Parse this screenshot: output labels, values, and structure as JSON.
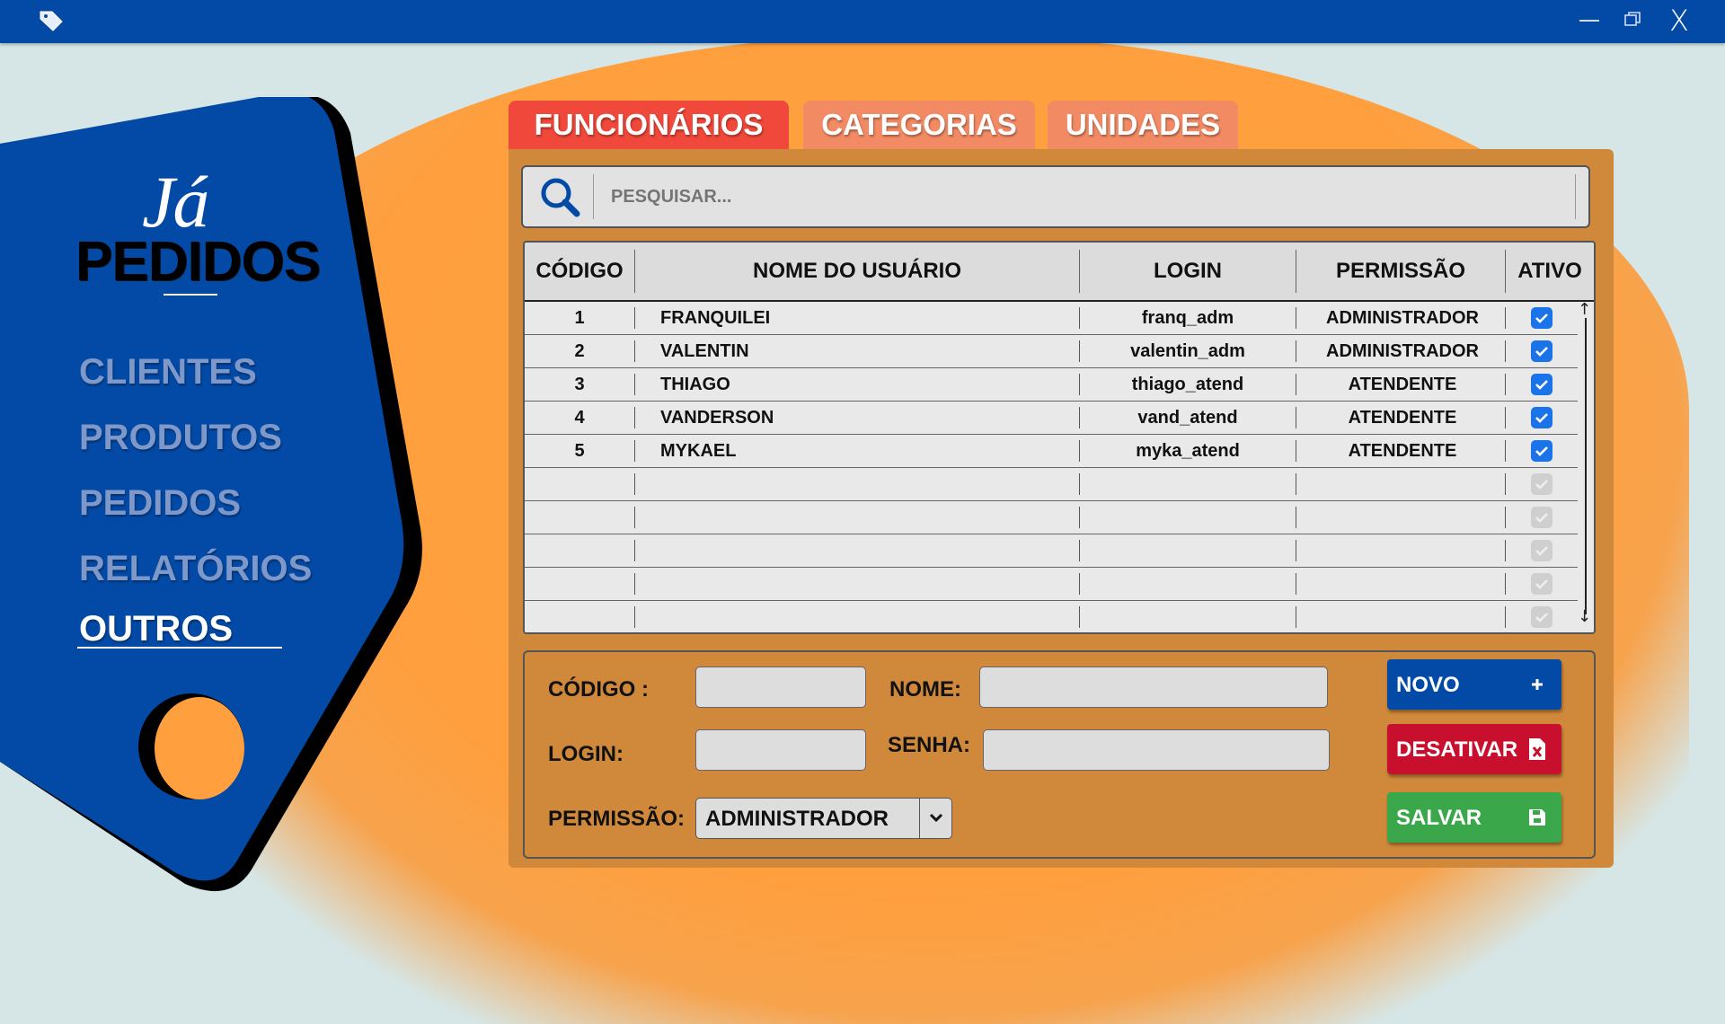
{
  "window": {
    "close_label": "X"
  },
  "brand": {
    "ja": "Já",
    "pedidos": "PEDIDOS"
  },
  "nav": {
    "items": [
      {
        "label": "CLIENTES"
      },
      {
        "label": "PRODUTOS"
      },
      {
        "label": "PEDIDOS"
      },
      {
        "label": "RELATÓRIOS"
      },
      {
        "label": "OUTROS",
        "active": true
      }
    ]
  },
  "tabs": [
    {
      "label": "FUNCIONÁRIOS",
      "active": true
    },
    {
      "label": "CATEGORIAS"
    },
    {
      "label": "UNIDADES"
    }
  ],
  "search": {
    "placeholder": "PESQUISAR..."
  },
  "table": {
    "headers": [
      "CÓDIGO",
      "NOME DO USUÁRIO",
      "LOGIN",
      "PERMISSÃO",
      "ATIVO"
    ],
    "rows": [
      {
        "code": "1",
        "name": "FRANQUILEI",
        "login": "franq_adm",
        "permission": "ADMINISTRADOR",
        "active": true
      },
      {
        "code": "2",
        "name": "VALENTIN",
        "login": "valentin_adm",
        "permission": "ADMINISTRADOR",
        "active": true
      },
      {
        "code": "3",
        "name": "THIAGO",
        "login": "thiago_atend",
        "permission": "ATENDENTE",
        "active": true
      },
      {
        "code": "4",
        "name": "VANDERSON",
        "login": "vand_atend",
        "permission": "ATENDENTE",
        "active": true
      },
      {
        "code": "5",
        "name": "MYKAEL",
        "login": "myka_atend",
        "permission": "ATENDENTE",
        "active": true
      },
      {
        "code": "",
        "name": "",
        "login": "",
        "permission": "",
        "active": false
      },
      {
        "code": "",
        "name": "",
        "login": "",
        "permission": "",
        "active": false
      },
      {
        "code": "",
        "name": "",
        "login": "",
        "permission": "",
        "active": false
      },
      {
        "code": "",
        "name": "",
        "login": "",
        "permission": "",
        "active": false
      },
      {
        "code": "",
        "name": "",
        "login": "",
        "permission": "",
        "active": false
      }
    ]
  },
  "form": {
    "code_label": "CÓDIGO :",
    "name_label": "NOME:",
    "login_label": "LOGIN:",
    "password_label": "SENHA:",
    "permission_label": "PERMISSÃO:",
    "permission_value": "ADMINISTRADOR",
    "code_value": "",
    "name_value": "",
    "login_value": "",
    "password_value": ""
  },
  "buttons": {
    "novo": "NOVO",
    "desativar": "DESATIVAR",
    "salvar": "SALVAR"
  },
  "colors": {
    "primary": "#034aa6",
    "accent": "#ff9f3e",
    "panel": "#d0893a",
    "tab_active": "#f0483a",
    "tab_inactive": "#f28a64",
    "danger": "#c8102e",
    "success": "#3aa84a",
    "checkbox": "#1a73e8"
  }
}
